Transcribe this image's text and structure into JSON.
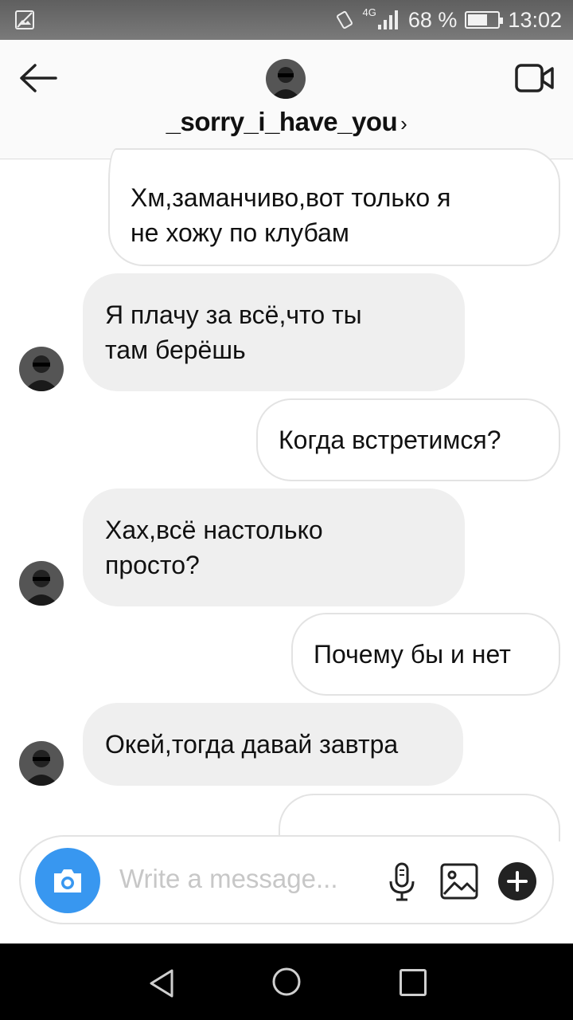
{
  "status_bar": {
    "network": "4G",
    "battery_percent": "68 %",
    "battery_level": 0.68,
    "time": "13:02",
    "icons": [
      "image-icon",
      "vibrate-icon",
      "signal-icon",
      "battery-icon"
    ]
  },
  "header": {
    "username": "_sorry_i_have_you",
    "chevron": "›",
    "icons": [
      "back-arrow-icon",
      "avatar",
      "video-call-icon"
    ]
  },
  "messages": [
    {
      "direction": "outgoing",
      "lines": [
        "Хм,заманчиво,вот только я",
        "не хожу по клубам"
      ]
    },
    {
      "direction": "incoming",
      "lines": [
        "Я плачу за всё,что ты",
        "там берёшь"
      ]
    },
    {
      "direction": "outgoing",
      "lines": [
        "Когда встретимся?"
      ]
    },
    {
      "direction": "incoming",
      "lines": [
        "Хах,всё настолько",
        "просто?"
      ]
    },
    {
      "direction": "outgoing",
      "lines": [
        "Почему бы и нет"
      ]
    },
    {
      "direction": "incoming",
      "lines": [
        "Окей,тогда давай завтра"
      ]
    }
  ],
  "composer": {
    "placeholder": "Write a message...",
    "icons": [
      "camera-icon",
      "microphone-icon",
      "gallery-icon",
      "plus-icon"
    ],
    "accent_color": "#3897f0"
  },
  "nav_bar": {
    "icons": [
      "nav-back-icon",
      "nav-home-icon",
      "nav-recents-icon"
    ]
  }
}
